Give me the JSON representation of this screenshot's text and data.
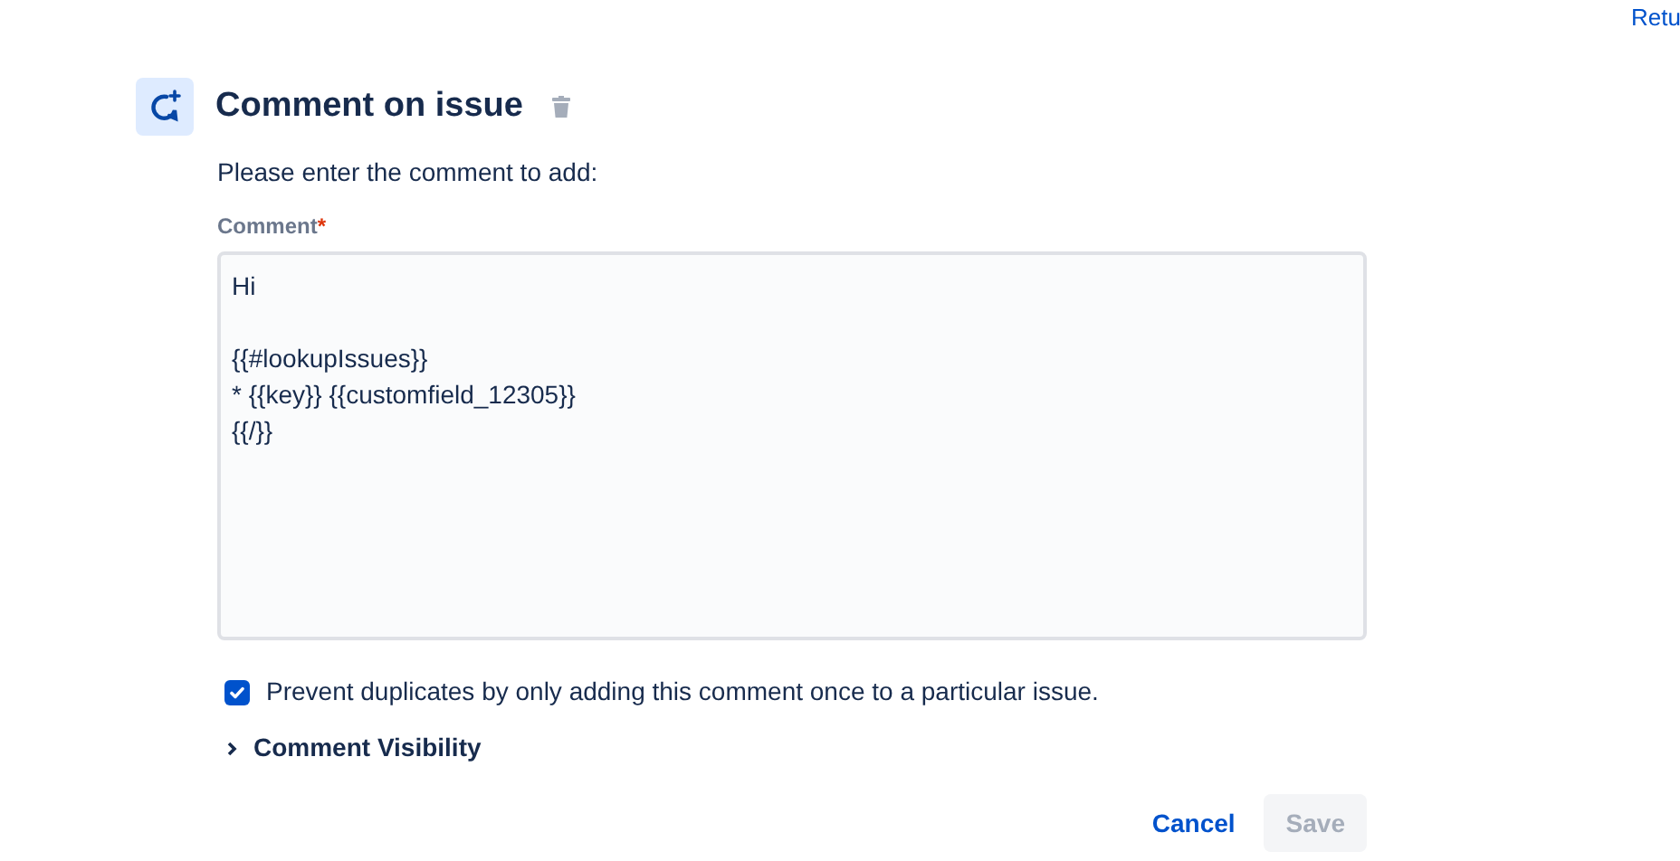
{
  "top_link": "Retu",
  "header": {
    "title": "Comment on issue"
  },
  "instruction": "Please enter the comment to add:",
  "comment_field": {
    "label": "Comment",
    "required_mark": "*",
    "value": "Hi\n\n{{#lookupIssues}}\n* {{key}} {{customfield_12305}}\n{{/}}"
  },
  "prevent_duplicates": {
    "label": "Prevent duplicates by only adding this comment once to a particular issue.",
    "checked": true
  },
  "visibility": {
    "label": "Comment Visibility",
    "expanded": false
  },
  "buttons": [
    {
      "label": "Cancel",
      "kind": "link",
      "disabled": false
    },
    {
      "label": "Save",
      "kind": "primary",
      "disabled": true
    }
  ]
}
